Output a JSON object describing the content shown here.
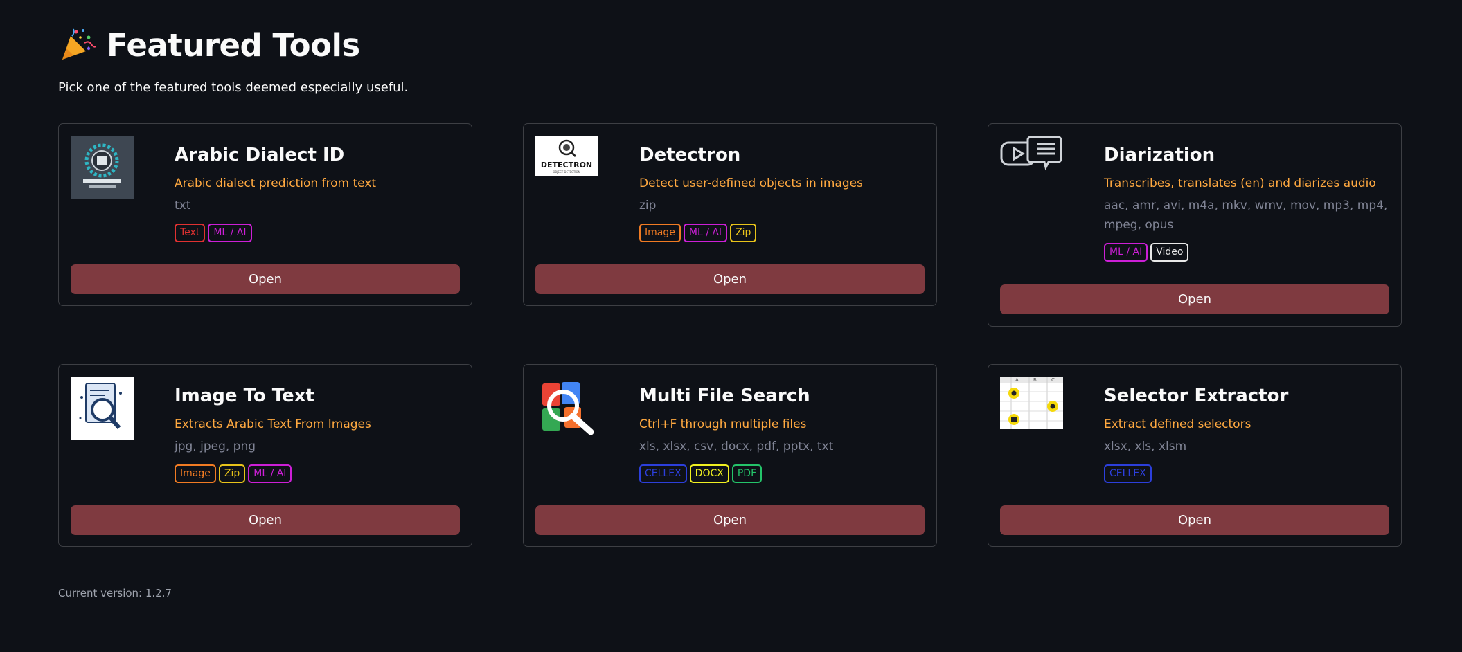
{
  "header": {
    "title": "Featured Tools",
    "subtitle": "Pick one of the featured tools deemed especially useful."
  },
  "button_label": "Open",
  "tag_colors": {
    "Text": "#e03131",
    "ML / AI": "#cc1fd6",
    "Image": "#f07b23",
    "Zip": "#e8c31a",
    "Video": "#e8e8e8",
    "CELLEX": "#2c3fdb",
    "DOCX": "#f0f020",
    "PDF": "#24c46a"
  },
  "tools": [
    {
      "name": "Arabic Dialect ID",
      "description": "Arabic dialect prediction from text",
      "extensions": "txt",
      "tags": [
        "Text",
        "ML / AI"
      ],
      "icon": "arabic-dialect-logo"
    },
    {
      "name": "Detectron",
      "description": "Detect user-defined objects in images",
      "extensions": "zip",
      "tags": [
        "Image",
        "ML / AI",
        "Zip"
      ],
      "icon": "detectron-logo",
      "logo_text": "DETECTRON",
      "logo_subtext": "OBJECT DETECTION"
    },
    {
      "name": "Diarization",
      "description": "Transcribes, translates (en) and diarizes audio",
      "extensions": "aac, amr, avi, m4a, mkv, wmv, mov, mp3, mp4, mpeg, opus",
      "tags": [
        "ML / AI",
        "Video"
      ],
      "icon": "video-chat-icon"
    },
    {
      "name": "Image To Text",
      "description": "Extracts Arabic Text From Images",
      "extensions": "jpg, jpeg, png",
      "tags": [
        "Image",
        "Zip",
        "ML / AI"
      ],
      "icon": "document-search-icon"
    },
    {
      "name": "Multi File Search",
      "description": "Ctrl+F through multiple files",
      "extensions": "xls, xlsx, csv, docx, pdf, pptx, txt",
      "tags": [
        "CELLEX",
        "DOCX",
        "PDF"
      ],
      "icon": "files-magnifier-icon"
    },
    {
      "name": "Selector Extractor",
      "description": "Extract defined selectors",
      "extensions": "xlsx, xls, xlsm",
      "tags": [
        "CELLEX"
      ],
      "icon": "spreadsheet-selectors-icon",
      "sheet_columns": [
        "A",
        "B",
        "C"
      ]
    }
  ],
  "footer": {
    "version_text": "Current version: 1.2.7"
  }
}
